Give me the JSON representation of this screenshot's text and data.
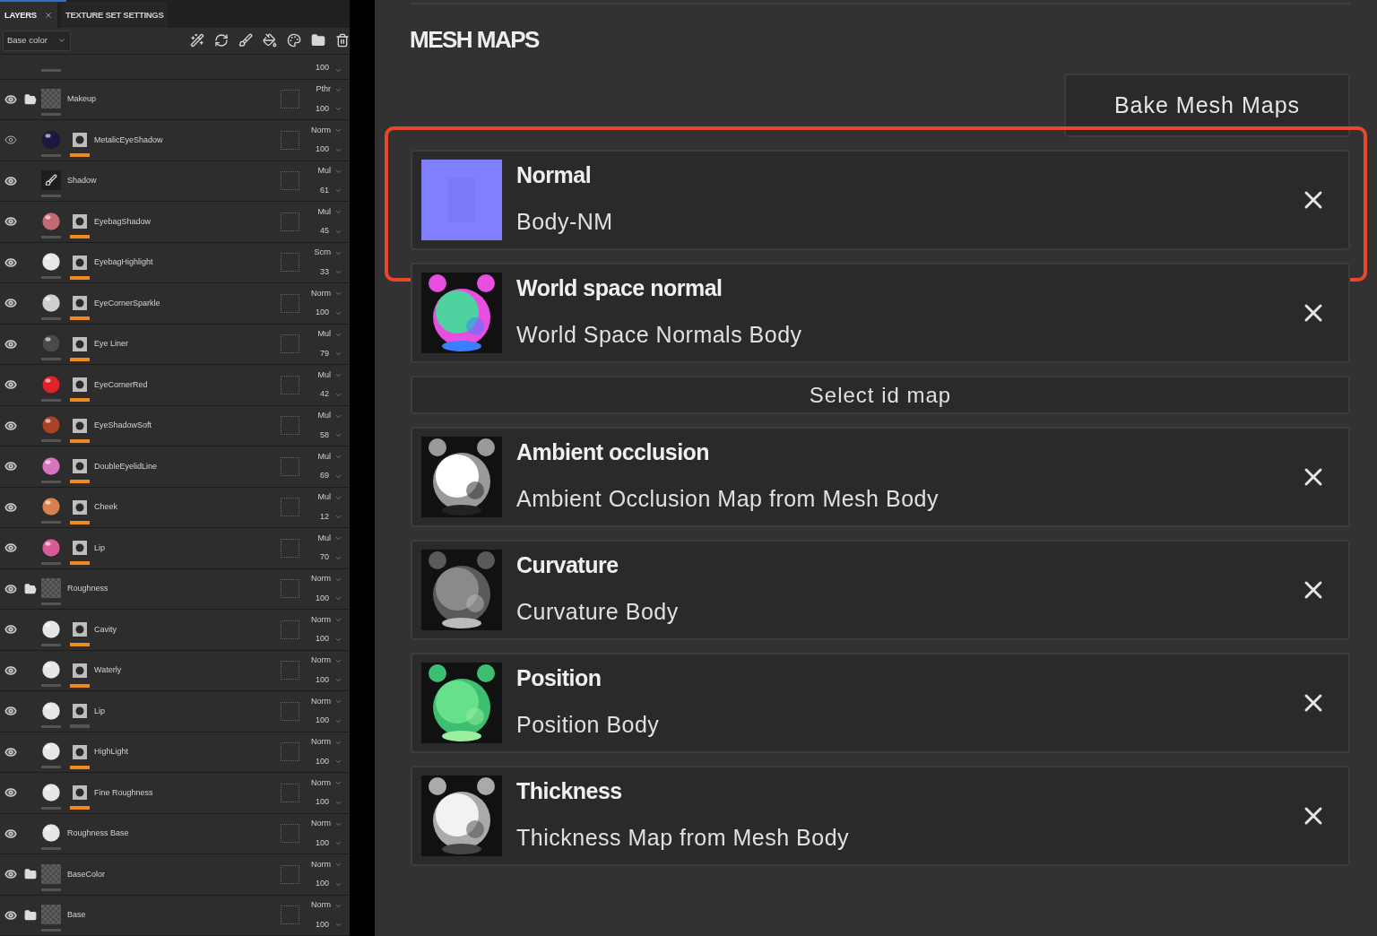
{
  "layers_panel": {
    "tabs": [
      {
        "label": "LAYERS",
        "selected": true,
        "closable": true
      },
      {
        "label": "TEXTURE SET SETTINGS",
        "selected": false,
        "closable": false
      }
    ],
    "channel_dropdown": "Base color",
    "layers": [
      {
        "kind": "clipped",
        "opacity": "100"
      },
      {
        "kind": "folder",
        "expanded": true,
        "visible": true,
        "name": "Makeup",
        "blend": "Pthr",
        "opacity": "100",
        "masked": false
      },
      {
        "kind": "fill",
        "color": "#1a1a40",
        "visible": false,
        "name": "MetalicEyeShadow",
        "blend": "Norm",
        "opacity": "100",
        "masked": true,
        "mask_enabled": true
      },
      {
        "kind": "paint",
        "visible": true,
        "name": "Shadow",
        "blend": "Mul",
        "opacity": "61",
        "masked": false
      },
      {
        "kind": "fill",
        "color": "#c46a72",
        "visible": true,
        "name": "EyebagShadow",
        "blend": "Mul",
        "opacity": "45",
        "masked": true,
        "mask_enabled": true
      },
      {
        "kind": "fill",
        "color": "#e8e8e8",
        "visible": true,
        "name": "EyebagHighlight",
        "blend": "Scrn",
        "opacity": "33",
        "masked": true,
        "mask_enabled": true
      },
      {
        "kind": "fill",
        "color": "#cfcfcf",
        "visible": true,
        "name": "EyeCornerSparkle",
        "blend": "Norm",
        "opacity": "100",
        "masked": true,
        "mask_enabled": true
      },
      {
        "kind": "fill",
        "color": "#4a4a4a",
        "visible": true,
        "name": "Eye Liner",
        "blend": "Mul",
        "opacity": "79",
        "masked": true,
        "mask_enabled": true
      },
      {
        "kind": "fill",
        "color": "#e0222a",
        "visible": true,
        "name": "EyeCornerRed",
        "blend": "Mul",
        "opacity": "42",
        "masked": true,
        "mask_enabled": true
      },
      {
        "kind": "fill",
        "color": "#a8432a",
        "visible": true,
        "name": "EyeShadowSoft",
        "blend": "Mul",
        "opacity": "58",
        "masked": true,
        "mask_enabled": true
      },
      {
        "kind": "fill",
        "color": "#d873c0",
        "visible": true,
        "name": "DoubleEyelidLine",
        "blend": "Mul",
        "opacity": "69",
        "masked": true,
        "mask_enabled": true
      },
      {
        "kind": "fill",
        "color": "#d98050",
        "visible": true,
        "name": "Cheek",
        "blend": "Mul",
        "opacity": "12",
        "masked": true,
        "mask_enabled": true
      },
      {
        "kind": "fill",
        "color": "#d85a9a",
        "visible": true,
        "name": "Lip",
        "blend": "Mul",
        "opacity": "70",
        "masked": true,
        "mask_enabled": true
      },
      {
        "kind": "folder",
        "expanded": true,
        "visible": true,
        "name": "Roughness",
        "blend": "Norm",
        "opacity": "100",
        "masked": false
      },
      {
        "kind": "fill",
        "color": "#e6e6e6",
        "visible": true,
        "name": "Cavity",
        "blend": "Norm",
        "opacity": "100",
        "masked": true,
        "mask_enabled": true
      },
      {
        "kind": "fill",
        "color": "#e6e6e6",
        "visible": true,
        "name": "Waterly",
        "blend": "Norm",
        "opacity": "100",
        "masked": true,
        "mask_enabled": true
      },
      {
        "kind": "fill",
        "color": "#e6e6e6",
        "visible": true,
        "name": "Lip",
        "blend": "Norm",
        "opacity": "100",
        "masked": true,
        "mask_enabled": false
      },
      {
        "kind": "fill",
        "color": "#e6e6e6",
        "visible": true,
        "name": "HighLight",
        "blend": "Norm",
        "opacity": "100",
        "masked": true,
        "mask_enabled": true
      },
      {
        "kind": "fill",
        "color": "#e6e6e6",
        "visible": true,
        "name": "Fine Roughness",
        "blend": "Norm",
        "opacity": "100",
        "masked": true,
        "mask_enabled": true
      },
      {
        "kind": "fill",
        "color": "#e6e6e6",
        "visible": true,
        "name": "Roughness Base",
        "blend": "Norm",
        "opacity": "100",
        "masked": false
      },
      {
        "kind": "folder",
        "expanded": false,
        "visible": true,
        "name": "BaseColor",
        "blend": "Norm",
        "opacity": "100",
        "masked": false
      },
      {
        "kind": "folder",
        "expanded": false,
        "visible": true,
        "name": "Base",
        "blend": "Norm",
        "opacity": "100",
        "masked": false
      }
    ]
  },
  "mesh_maps": {
    "title": "MESH MAPS",
    "bake_button": "Bake Mesh Maps",
    "items": [
      {
        "kind": "map",
        "title": "Normal",
        "subtitle": "Body-NM",
        "highlighted": true
      },
      {
        "kind": "map",
        "title": "World space normal",
        "subtitle": "World Space Normals Body",
        "highlighted": false
      },
      {
        "kind": "select",
        "label": "Select id map"
      },
      {
        "kind": "map",
        "title": "Ambient occlusion",
        "subtitle": "Ambient Occlusion Map from Mesh Body",
        "highlighted": false
      },
      {
        "kind": "map",
        "title": "Curvature",
        "subtitle": "Curvature Body",
        "highlighted": false
      },
      {
        "kind": "map",
        "title": "Position",
        "subtitle": "Position Body",
        "highlighted": false
      },
      {
        "kind": "map",
        "title": "Thickness",
        "subtitle": "Thickness Map from Mesh Body",
        "highlighted": false
      }
    ]
  }
}
